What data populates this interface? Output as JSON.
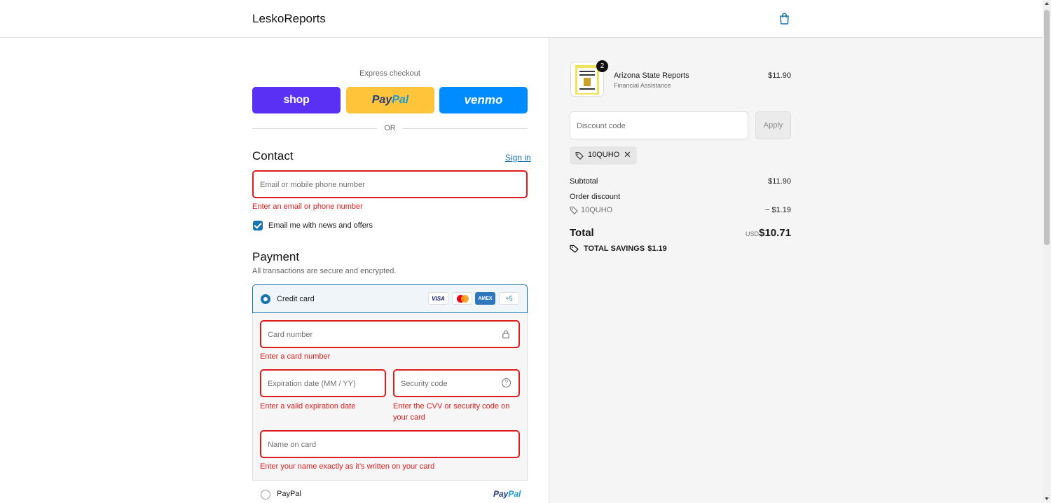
{
  "header": {
    "brand": "LeskoReports",
    "cart_icon": "shopping-bag-icon"
  },
  "express": {
    "label": "Express checkout",
    "shop": "shop",
    "paypal_a": "Pay",
    "paypal_b": "Pal",
    "venmo": "venmo",
    "or": "OR"
  },
  "contact": {
    "title": "Contact",
    "sign_in": "Sign in",
    "email_placeholder": "Email or mobile phone number",
    "email_error": "Enter an email or phone number",
    "newsletter_label": "Email me with news and offers",
    "newsletter_checked": true
  },
  "payment": {
    "title": "Payment",
    "subtitle": "All transactions are secure and encrypted.",
    "credit_card_label": "Credit card",
    "brands": {
      "visa": "VISA",
      "amex": "AMEX",
      "more": "+5"
    },
    "card_number_placeholder": "Card number",
    "card_number_error": "Enter a card number",
    "expiry_placeholder": "Expiration date (MM / YY)",
    "expiry_error": "Enter a valid expiration date",
    "cvv_placeholder": "Security code",
    "cvv_error": "Enter the CVV or security code on your card",
    "name_placeholder": "Name on card",
    "name_error": "Enter your name exactly as it’s written on your card",
    "paypal_label": "PayPal",
    "paypal_logo_a": "Pay",
    "paypal_logo_b": "Pal"
  },
  "order": {
    "item": {
      "title": "Arizona State Reports",
      "subtitle": "Financial Assistance",
      "price": "$11.90",
      "quantity": "2"
    },
    "discount_placeholder": "Discount code",
    "apply": "Apply",
    "applied_code": "10QUHO",
    "subtotal_label": "Subtotal",
    "subtotal_value": "$11.90",
    "order_discount_label": "Order discount",
    "discount_code": "10QUHO",
    "discount_value": "− $1.19",
    "total_label": "Total",
    "currency": "USD",
    "total_value": "$10.71",
    "savings_label": "TOTAL SAVINGS",
    "savings_value": "$1.19"
  },
  "colors": {
    "accent": "#1773b0",
    "error": "#dd1d1d",
    "shop": "#5a31f4",
    "paypal": "#ffc439",
    "venmo": "#008cff"
  }
}
